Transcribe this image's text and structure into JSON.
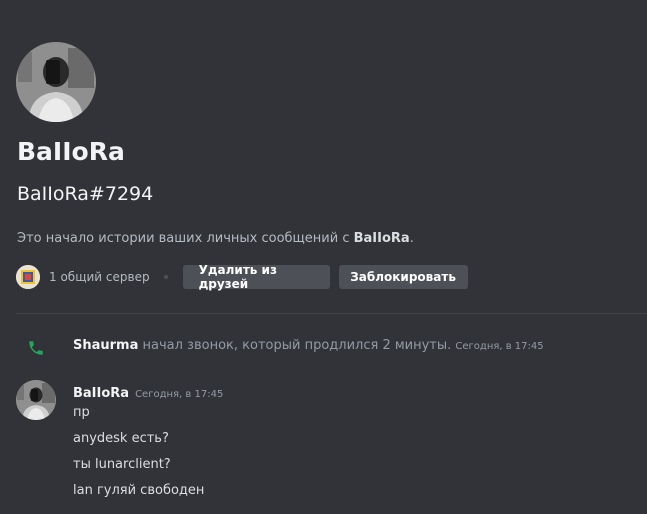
{
  "profile": {
    "username": "BaIIoRa",
    "tag": "BaIIoRa#7294",
    "intro_prefix": "Это начало истории ваших личных сообщений с ",
    "intro_name": "BaIIoRa",
    "intro_suffix": ".",
    "mutual_servers": "1 общий сервер",
    "remove_friend_label": "Удалить из друзей",
    "block_label": "Заблокировать",
    "avatar_icon": "profile-avatar",
    "server_icon": "server-icon"
  },
  "call_event": {
    "icon": "phone-icon",
    "user": "Shaurma",
    "text": " начал звонок, который продлился 2 минуты. ",
    "timestamp": "Сегодня, в 17:45"
  },
  "message_group": {
    "author": "BaIIoRa",
    "timestamp": "Сегодня, в 17:45",
    "lines": [
      "пр",
      "anydesk есть?",
      "ты lunarclient?",
      "lan гуляй свободен"
    ]
  },
  "colors": {
    "background": "#313338",
    "button": "#4e5058",
    "call_green": "#23a55a"
  }
}
